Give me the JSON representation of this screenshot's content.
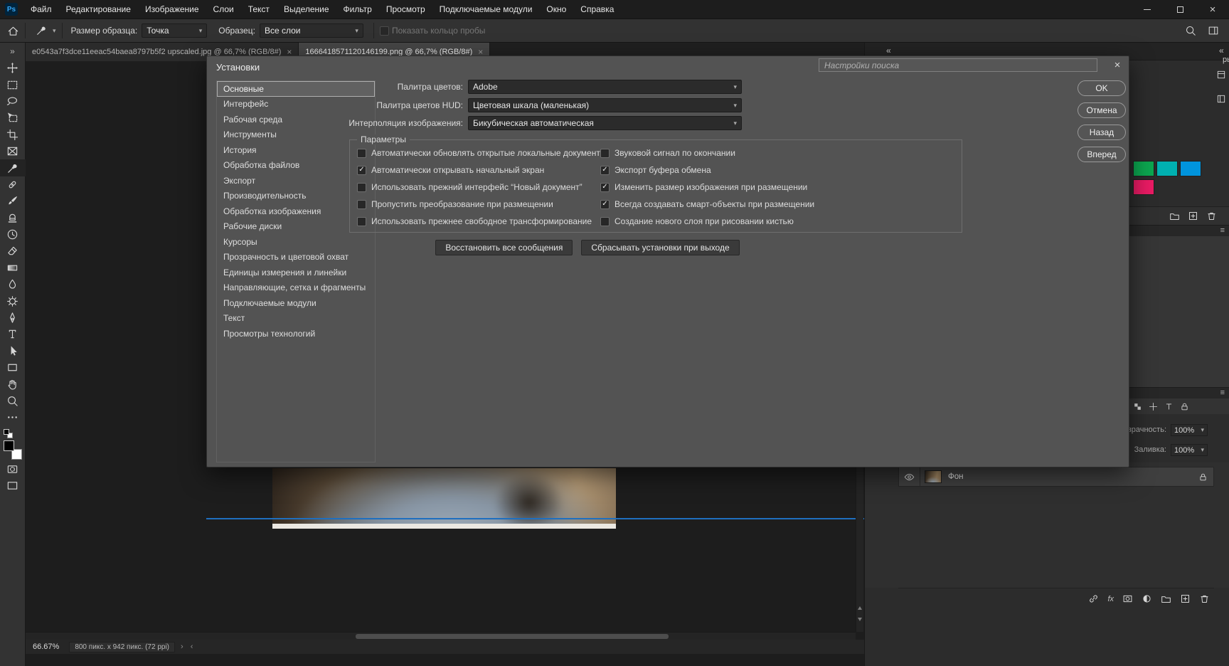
{
  "menubar": {
    "logo": "Ps",
    "menus": [
      "Файл",
      "Редактирование",
      "Изображение",
      "Слои",
      "Текст",
      "Выделение",
      "Фильтр",
      "Просмотр",
      "Подключаемые модули",
      "Окно",
      "Справка"
    ]
  },
  "options_bar": {
    "sample_size_label": "Размер образца:",
    "sample_size_value": "Точка",
    "sample_label": "Образец:",
    "sample_value": "Все слои",
    "show_ring_label": "Показать кольцо пробы"
  },
  "tabs": [
    {
      "label": "e0543a7f3dce11eeac54baea8797b5f2 upscaled.jpg @ 66,7% (RGB/8#)",
      "active": false
    },
    {
      "label": "1666418571120146199.png @ 66,7% (RGB/8#)",
      "active": true
    }
  ],
  "dialog": {
    "title": "Установки",
    "search_placeholder": "Настройки поиска",
    "categories": [
      {
        "label": "Основные",
        "selected": true
      },
      {
        "label": "Интерфейс",
        "selected": false
      },
      {
        "label": "Рабочая среда",
        "selected": false
      },
      {
        "label": "Инструменты",
        "selected": false
      },
      {
        "label": "История",
        "selected": false
      },
      {
        "label": "Обработка файлов",
        "selected": false
      },
      {
        "label": "Экспорт",
        "selected": false
      },
      {
        "label": "Производительность",
        "selected": false
      },
      {
        "label": "Обработка изображения",
        "selected": false
      },
      {
        "label": "Рабочие диски",
        "selected": false
      },
      {
        "label": "Курсоры",
        "selected": false
      },
      {
        "label": "Прозрачность и цветовой охват",
        "selected": false
      },
      {
        "label": "Единицы измерения и линейки",
        "selected": false
      },
      {
        "label": "Направляющие, сетка и фрагменты",
        "selected": false
      },
      {
        "label": "Подключаемые модули",
        "selected": false
      },
      {
        "label": "Текст",
        "selected": false
      },
      {
        "label": "Просмотры технологий",
        "selected": false
      }
    ],
    "fields": [
      {
        "label": "Палитра цветов:",
        "value": "Adobe"
      },
      {
        "label": "Палитра цветов HUD:",
        "value": "Цветовая шкала (маленькая)"
      },
      {
        "label": "Интерполяция изображения:",
        "value": "Бикубическая автоматическая"
      }
    ],
    "options_group": {
      "title": "Параметры",
      "left": [
        {
          "label": "Автоматически обновлять открытые локальные документы",
          "checked": false
        },
        {
          "label": "Автоматически открывать начальный экран",
          "checked": true
        },
        {
          "label": "Использовать прежний интерфейс “Новый документ”",
          "checked": false
        },
        {
          "label": "Пропустить преобразование при размещении",
          "checked": false
        },
        {
          "label": "Использовать прежнее свободное трансформирование",
          "checked": false
        }
      ],
      "right": [
        {
          "label": "Звуковой сигнал по окончании",
          "checked": false
        },
        {
          "label": "Экспорт буфера обмена",
          "checked": true
        },
        {
          "label": "Изменить размер изображения при размещении",
          "checked": true
        },
        {
          "label": "Всегда создавать смарт-объекты при размещении",
          "checked": true
        },
        {
          "label": "Создание нового слоя при рисовании кистью",
          "checked": false
        }
      ]
    },
    "reset_messages_button": "Восстановить все сообщения",
    "reset_on_quit_button": "Сбрасывать установки при выходе",
    "buttons": {
      "ok": "OK",
      "cancel": "Отмена",
      "back": "Назад",
      "forward": "Вперед"
    }
  },
  "panels": {
    "clipped_tab_text": "ры",
    "swatches": [
      "#0ca750",
      "#00b0b0",
      "#0094dd",
      "#ea1b64"
    ],
    "opacity_label": "Непрозрачность:",
    "opacity_value": "100%",
    "fill_label": "Заливка:",
    "fill_value": "100%",
    "layer_name": "Фон",
    "fx_label": "fx"
  },
  "status_bar": {
    "zoom": "66.67%",
    "doc_info": "800 пикс. x 942 пикс. (72 ppi)"
  }
}
